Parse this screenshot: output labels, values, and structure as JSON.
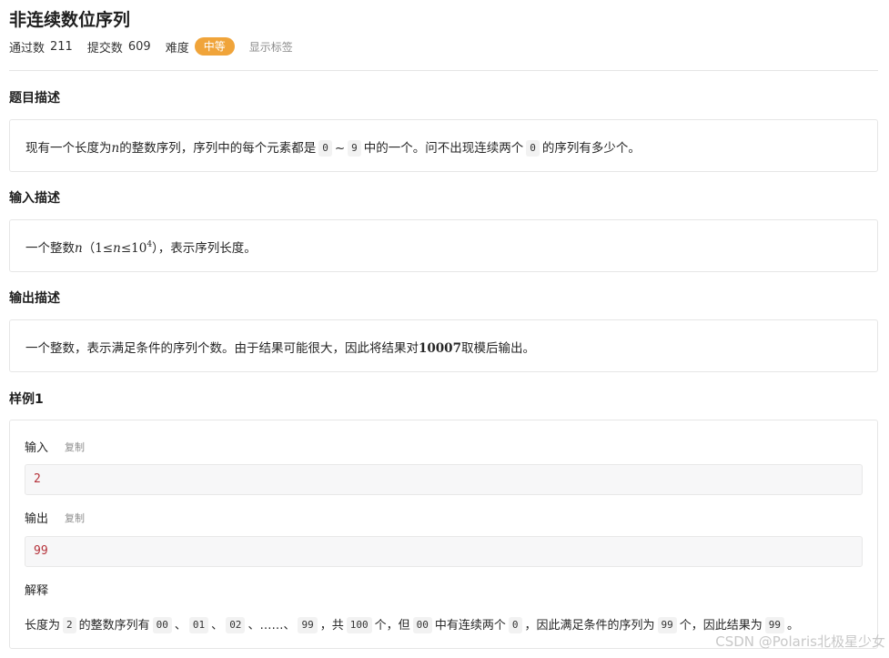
{
  "problem": {
    "title": "非连续数位序列",
    "pass_label": "通过数",
    "pass_count": "211",
    "submit_label": "提交数",
    "submit_count": "609",
    "difficulty_label": "难度",
    "difficulty": "中等",
    "show_tags": "显示标签"
  },
  "description": {
    "heading": "题目描述",
    "text_1": "现有一个长度为",
    "var_n": "n",
    "text_2": "的整数序列，序列中的每个元素都是",
    "code_0": "0",
    "tilde": "~",
    "code_9": "9",
    "text_3": "中的一个。问不出现连续两个",
    "code_zero": "0",
    "text_4": "的序列有多少个。"
  },
  "input_desc": {
    "heading": "输入描述",
    "text_1": "一个整数",
    "var_n": "n",
    "paren_open": "（1≤",
    "var_n2": "n",
    "le": "≤10",
    "exp": "4",
    "paren_close": "），表示序列长度。"
  },
  "output_desc": {
    "heading": "输出描述",
    "text_1": "一个整数，表示满足条件的序列个数。由于结果可能很大，因此将结果对",
    "modulus": "10007",
    "text_2": "取模后输出。"
  },
  "sample": {
    "heading": "样例1",
    "input_label": "输入",
    "output_label": "输出",
    "copy_label": "复制",
    "input_value": "2",
    "output_value": "99",
    "explain_label": "解释",
    "exp_1": "长度为",
    "exp_code_2": "2",
    "exp_2": "的整数序列有",
    "exp_code_00": "00",
    "sep_1": "、",
    "exp_code_01": "01",
    "sep_2": "、",
    "exp_code_02": "02",
    "sep_3": "、……、",
    "exp_code_99": "99",
    "exp_3": "，共",
    "exp_code_100": "100",
    "exp_4": "个，但",
    "exp_code_00b": "00",
    "exp_5": "中有连续两个",
    "exp_code_0": "0",
    "exp_6": "，因此满足条件的序列为",
    "exp_code_99b": "99",
    "exp_7": "个，因此结果为",
    "exp_code_99c": "99",
    "exp_8": "。"
  },
  "watermark": "CSDN @Polaris北极星少女"
}
